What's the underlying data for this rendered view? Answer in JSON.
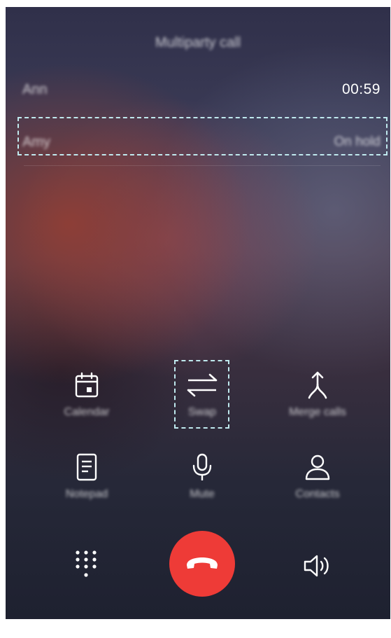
{
  "call": {
    "title": "Multiparty call",
    "active_caller": "Ann",
    "active_timer": "00:59",
    "held_caller": "Amy",
    "held_status": "On hold"
  },
  "actions": {
    "calendar": "Calendar",
    "swap": "Swap",
    "merge": "Merge calls",
    "notepad": "Notepad",
    "mute": "Mute",
    "contacts": "Contacts"
  },
  "colors": {
    "end_call": "#ee3b37",
    "highlight_border": "#bfe9ee"
  },
  "icons": {
    "calendar": "calendar-icon",
    "swap": "swap-arrows-icon",
    "merge": "merge-arrow-icon",
    "notepad": "notepad-icon",
    "mute": "microphone-icon",
    "contacts": "person-icon",
    "dialpad": "dialpad-icon",
    "end_call": "phone-hangup-icon",
    "speaker": "speaker-icon"
  }
}
